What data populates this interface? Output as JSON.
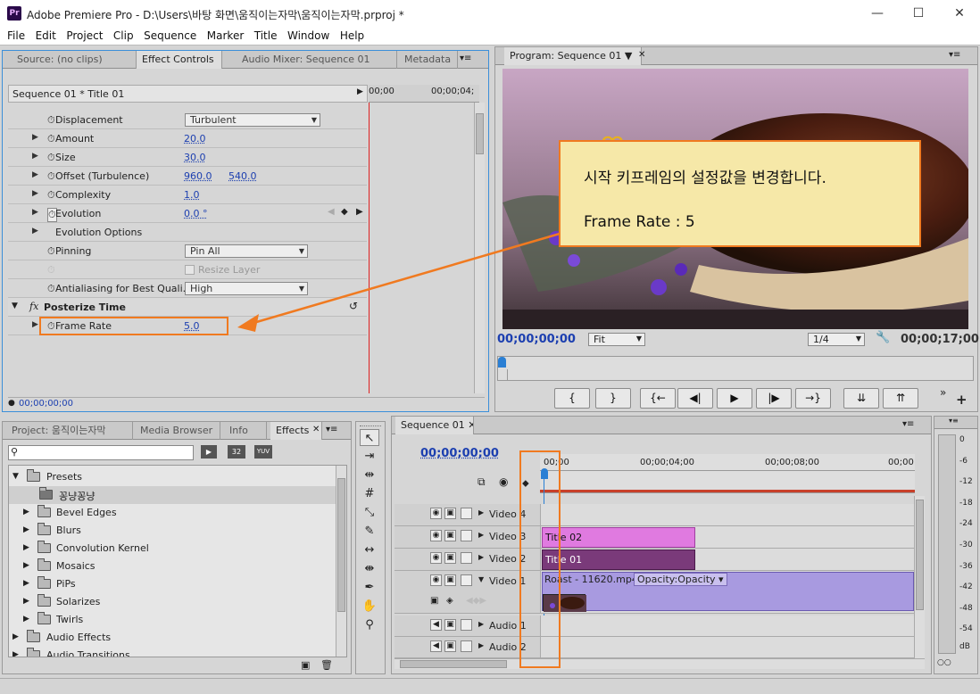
{
  "app": {
    "logo": "Pr",
    "title": "Adobe Premiere Pro - D:\\Users\\바탕 화면\\움직이는자막\\움직이는자막.prproj *",
    "window_controls": [
      "—",
      "☐",
      "✕"
    ]
  },
  "menu": [
    "File",
    "Edit",
    "Project",
    "Clip",
    "Sequence",
    "Marker",
    "Title",
    "Window",
    "Help"
  ],
  "top_left_tabs": [
    "Source: (no clips)",
    "Effect Controls",
    "Audio Mixer: Sequence 01",
    "Metadata"
  ],
  "effect_controls": {
    "header": "Sequence 01 * Title 01",
    "ruler": [
      "00;00",
      "00;00;04;"
    ],
    "rows": [
      {
        "label": "Displacement",
        "dropdown": "Turbulent"
      },
      {
        "label": "Amount",
        "value": "20.0"
      },
      {
        "label": "Size",
        "value": "30.0"
      },
      {
        "label": "Offset (Turbulence)",
        "value": "960.0",
        "value2": "540.0"
      },
      {
        "label": "Complexity",
        "value": "1.0"
      },
      {
        "label": "Evolution",
        "value": "0.0 °"
      },
      {
        "label": "Evolution Options"
      },
      {
        "label": "Pinning",
        "dropdown": "Pin All"
      },
      {
        "label": "Resize Layer"
      },
      {
        "label": "Antialiasing for Best Quali...",
        "dropdown": "High"
      }
    ],
    "effect_name": "Posterize Time",
    "frame_rate_label": "Frame Rate",
    "frame_rate_value": "5.0",
    "timecode": "00;00;00;00"
  },
  "program": {
    "tab": "Program: Sequence 01",
    "timecode": "00;00;00;00",
    "fit": "Fit",
    "res": "1/4",
    "duration": "00;00;17;00",
    "buttons": [
      "{",
      "}",
      "{←",
      "◀|",
      "▶",
      "|▶",
      "→}",
      "⇊",
      "⇈"
    ],
    "callout_line1": "시작 키프레임의 설정값을 변경합니다.",
    "callout_line2": "Frame Rate : 5",
    "callout_color": "#f6e8a8",
    "arrow_color": "#f07a20"
  },
  "bottom_left_tabs": [
    "Project: 움직이는자막",
    "Media Browser",
    "Info",
    "Effects"
  ],
  "effects_panel": {
    "badges": [
      "32",
      "YUV"
    ],
    "items": [
      {
        "label": "Presets",
        "level": 0,
        "open": true
      },
      {
        "label": "꽁냥꽁냥",
        "level": 1,
        "selected": true
      },
      {
        "label": "Bevel Edges",
        "level": 1
      },
      {
        "label": "Blurs",
        "level": 1
      },
      {
        "label": "Convolution Kernel",
        "level": 1
      },
      {
        "label": "Mosaics",
        "level": 1
      },
      {
        "label": "PiPs",
        "level": 1
      },
      {
        "label": "Solarizes",
        "level": 1
      },
      {
        "label": "Twirls",
        "level": 1
      },
      {
        "label": "Audio Effects",
        "level": 0
      },
      {
        "label": "Audio Transitions",
        "level": 0
      }
    ]
  },
  "timeline": {
    "tab": "Sequence 01",
    "timecode": "00;00;00;00",
    "ruler": [
      "00;00",
      "00;00;04;00",
      "00;00;08;00",
      "00;00"
    ],
    "tracks": [
      {
        "name": "Video 4"
      },
      {
        "name": "Video 3",
        "clip": "Title 02"
      },
      {
        "name": "Video 2",
        "clip": "Title 01"
      },
      {
        "name": "Video 1",
        "clip": "Roast - 11620.mp4",
        "fx": "Opacity:Opacity"
      },
      {
        "name": "Audio 1"
      },
      {
        "name": "Audio 2"
      }
    ]
  },
  "audio_meter": [
    "0",
    "-6",
    "-12",
    "-18",
    "-24",
    "-30",
    "-36",
    "-42",
    "-48",
    "-54",
    "dB"
  ],
  "meter_footer": "○○"
}
